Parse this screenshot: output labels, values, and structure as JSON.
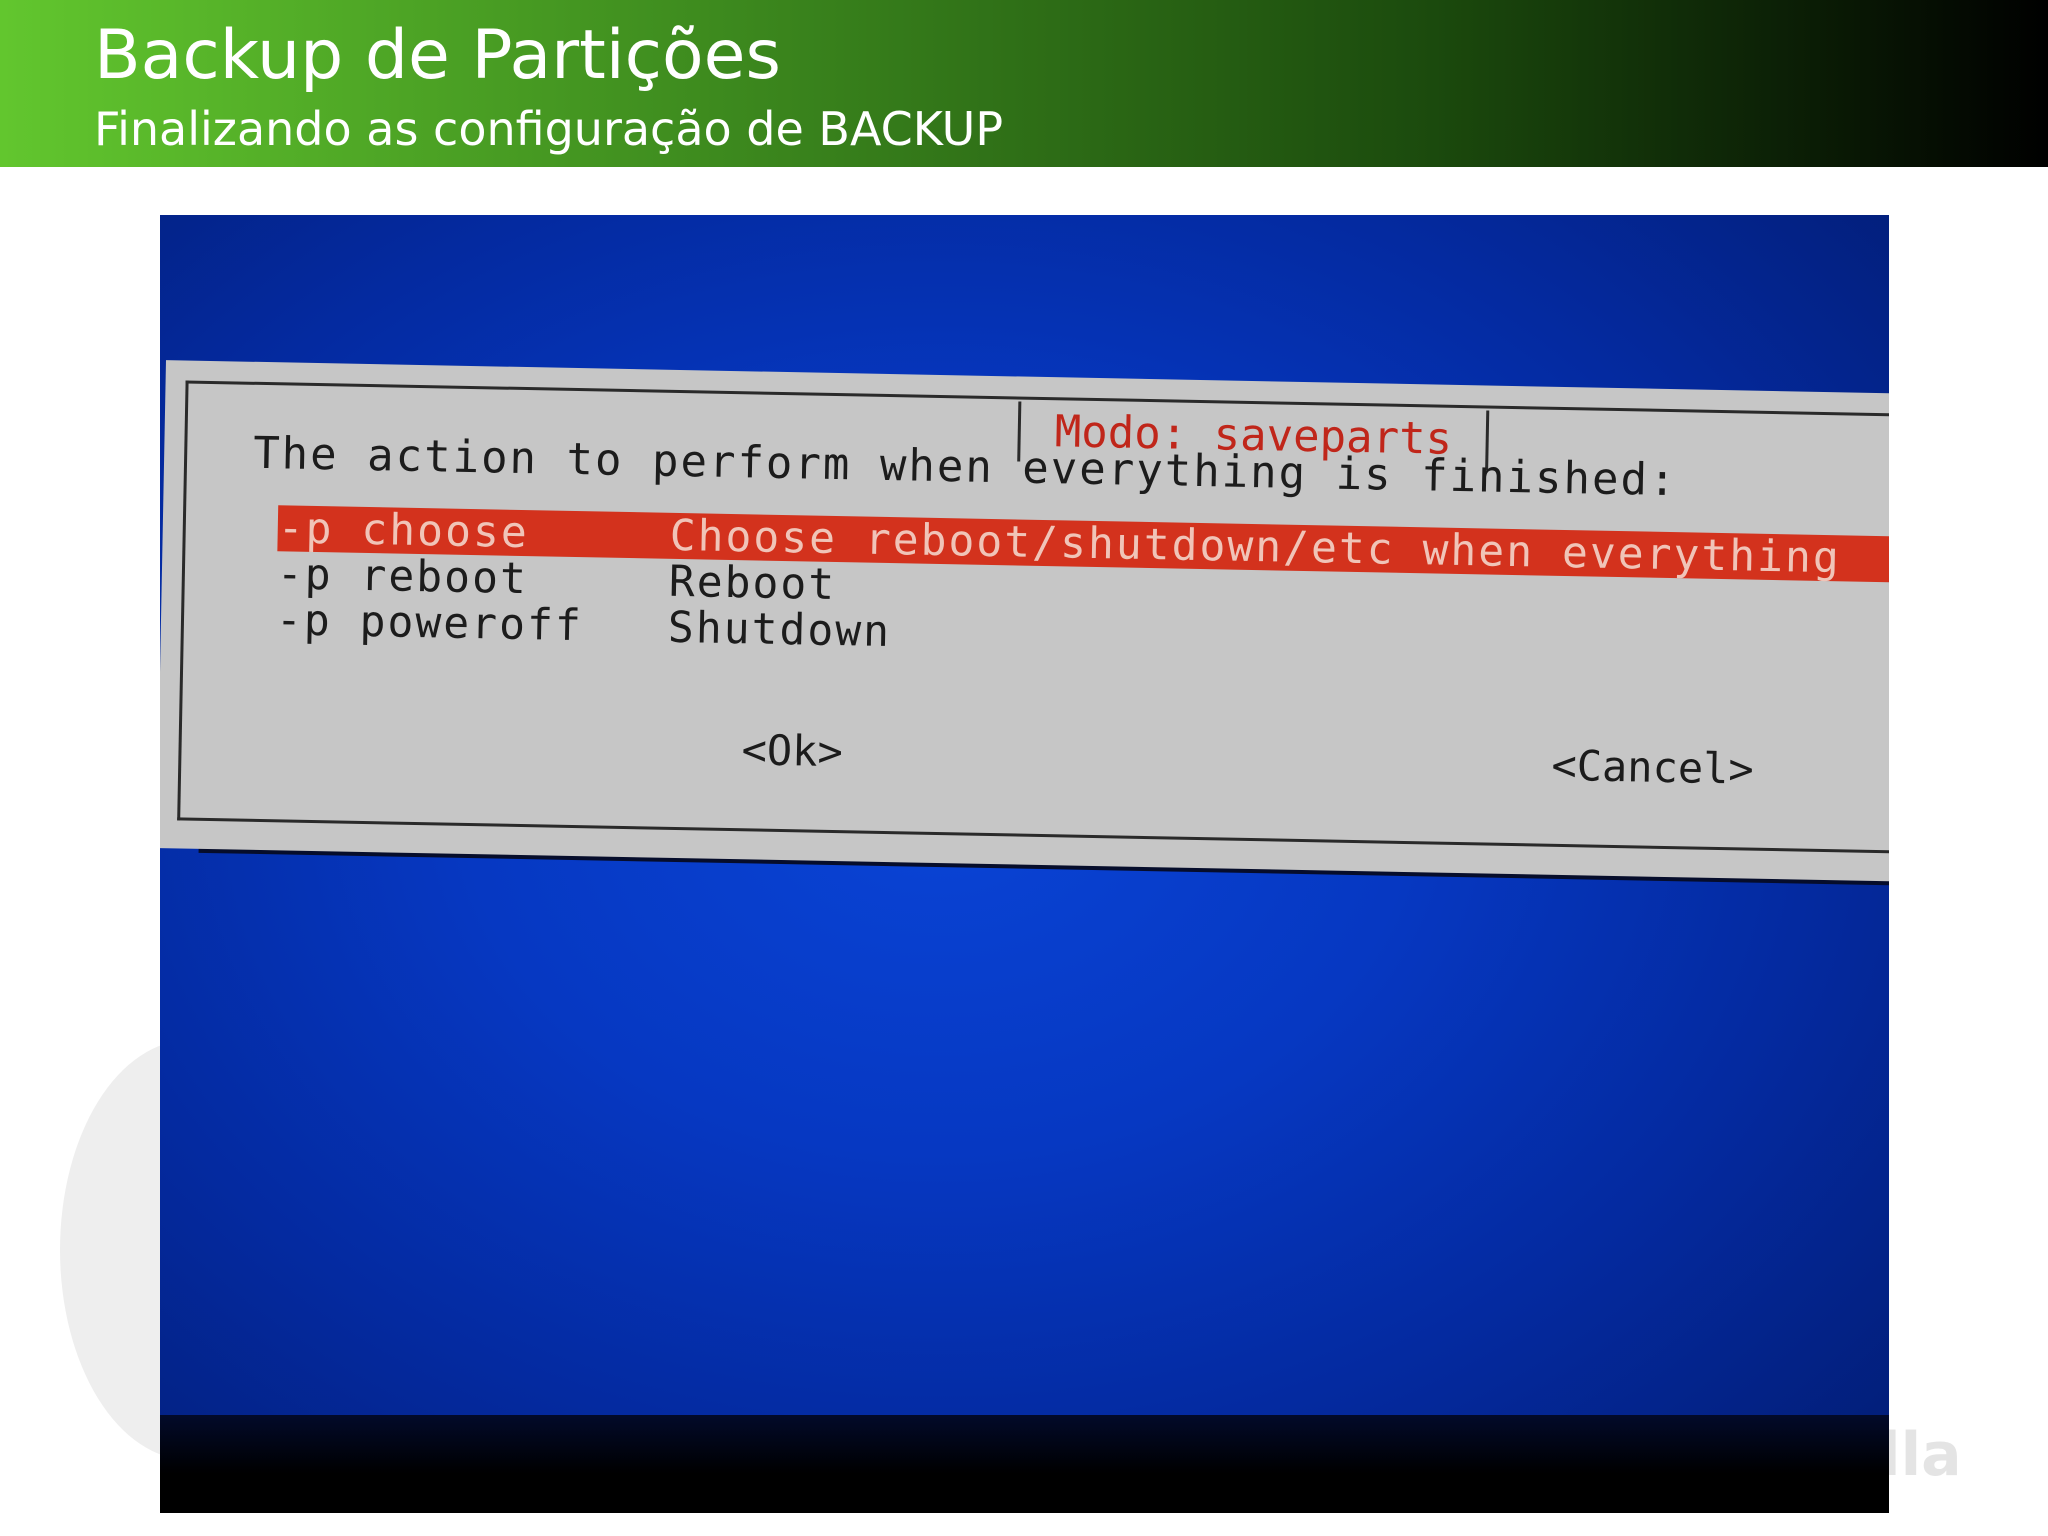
{
  "slide": {
    "title": "Backup de Partições",
    "subtitle": "Finalizando as configuração de BACKUP"
  },
  "watermark": "lla",
  "dialog": {
    "title": "Modo: saveparts",
    "prompt": "The action to perform when everything is finished:",
    "options": [
      {
        "tag": "-p choose",
        "description": "Choose reboot/shutdown/etc when everything",
        "selected": true
      },
      {
        "tag": "-p reboot",
        "description": "Reboot",
        "selected": false
      },
      {
        "tag": "-p poweroff",
        "description": "Shutdown",
        "selected": false
      }
    ],
    "ok_label": "<Ok>",
    "cancel_label": "<Cancel>"
  },
  "colors": {
    "header_gradient_start": "#62c62e",
    "header_gradient_end": "#000000",
    "screen_background": "#0638c2",
    "dialog_background": "#c6c6c6",
    "selection_highlight": "#d3321d",
    "dialog_title_text": "#c0261a"
  }
}
